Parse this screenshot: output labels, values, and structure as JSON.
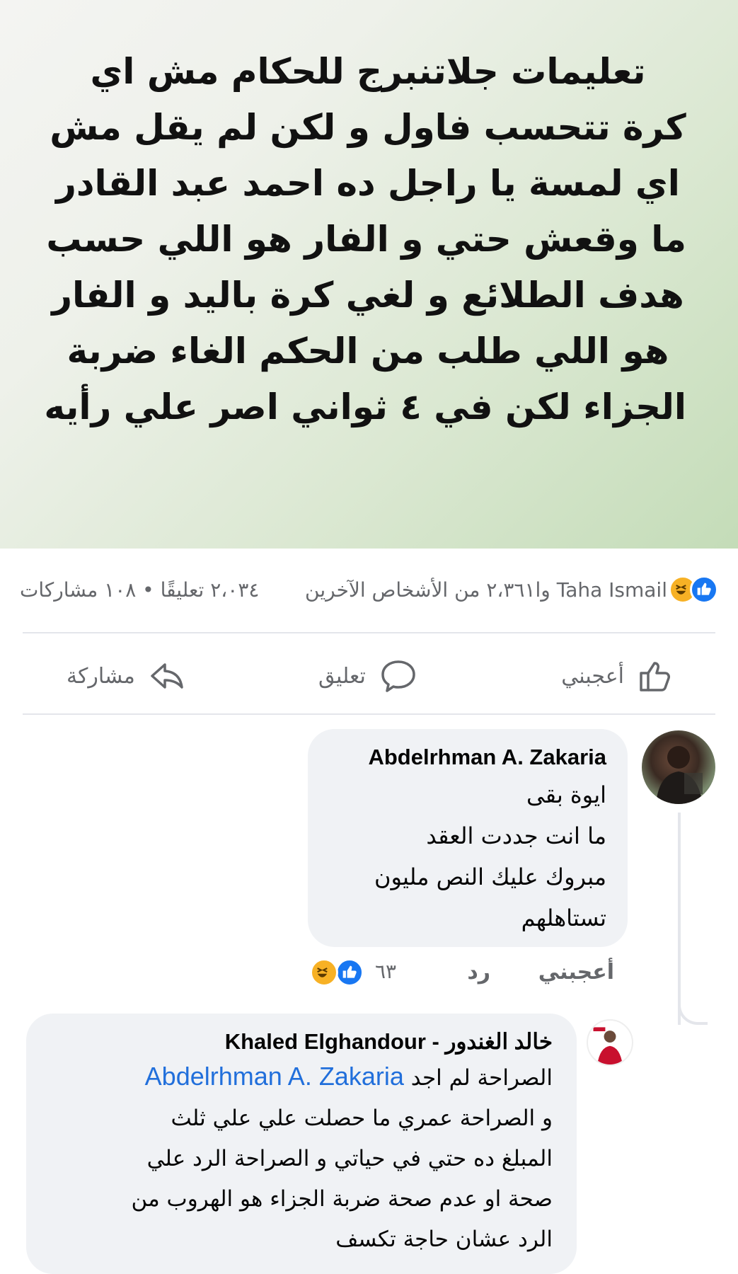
{
  "post": {
    "image_text_lines": [
      "تعليمات جلاتنبرج  للحكام مش اي",
      "كرة تتحسب فاول و لكن لم يقل مش",
      "اي لمسة  يا راجل ده احمد عبد القادر",
      "ما وقعش حتي و الفار هو اللي حسب",
      "هدف الطلائع  و لغي كرة باليد و الفار",
      "هو اللي طلب من الحكم الغاء ضربة",
      "الجزاء لكن في ٤ ثواني اصر علي رأيه"
    ],
    "image_background": [
      "#f4f4f2",
      "#c4dcb8"
    ]
  },
  "summary": {
    "reactions_text": "Taha Ismail وا٢،٣٦١ من الأشخاص الآخرين",
    "counts_text": "٢،٠٣٤ تعليقًا • ١٠٨ مشاركات",
    "reaction_icons": [
      "like-icon",
      "haha-icon"
    ]
  },
  "actions": {
    "like_label": "أعجبني",
    "comment_label": "تعليق",
    "share_label": "مشاركة"
  },
  "comments": [
    {
      "author": "Abdelrhman A. Zakaria",
      "lines": [
        "ايوة بقى",
        "ما انت جددت العقد",
        "مبروك عليك النص مليون",
        "تستاهلهم"
      ],
      "like_label": "أعجبني",
      "reply_label": "رد",
      "reaction_count": "٦٣",
      "reaction_icons": [
        "like-icon",
        "haha-icon"
      ]
    },
    {
      "author": "خالد الغندور - Khaled Elghandour",
      "mention": "Abdelrhman A. Zakaria",
      "first_line_text": "الصراحة لم اجد",
      "lines": [
        "و الصراحة عمري ما حصلت علي  علي ثلث",
        "المبلغ ده حتي في حياتي و الصراحة الرد علي",
        "صحة او عدم صحة ضربة الجزاء هو الهروب من",
        "الرد عشان حاجة تكسف"
      ]
    }
  ],
  "colors": {
    "accent_blue": "#1877f2",
    "mention_blue": "#216fdb",
    "muted_text": "#65676b",
    "bubble_bg": "#f0f2f5"
  }
}
